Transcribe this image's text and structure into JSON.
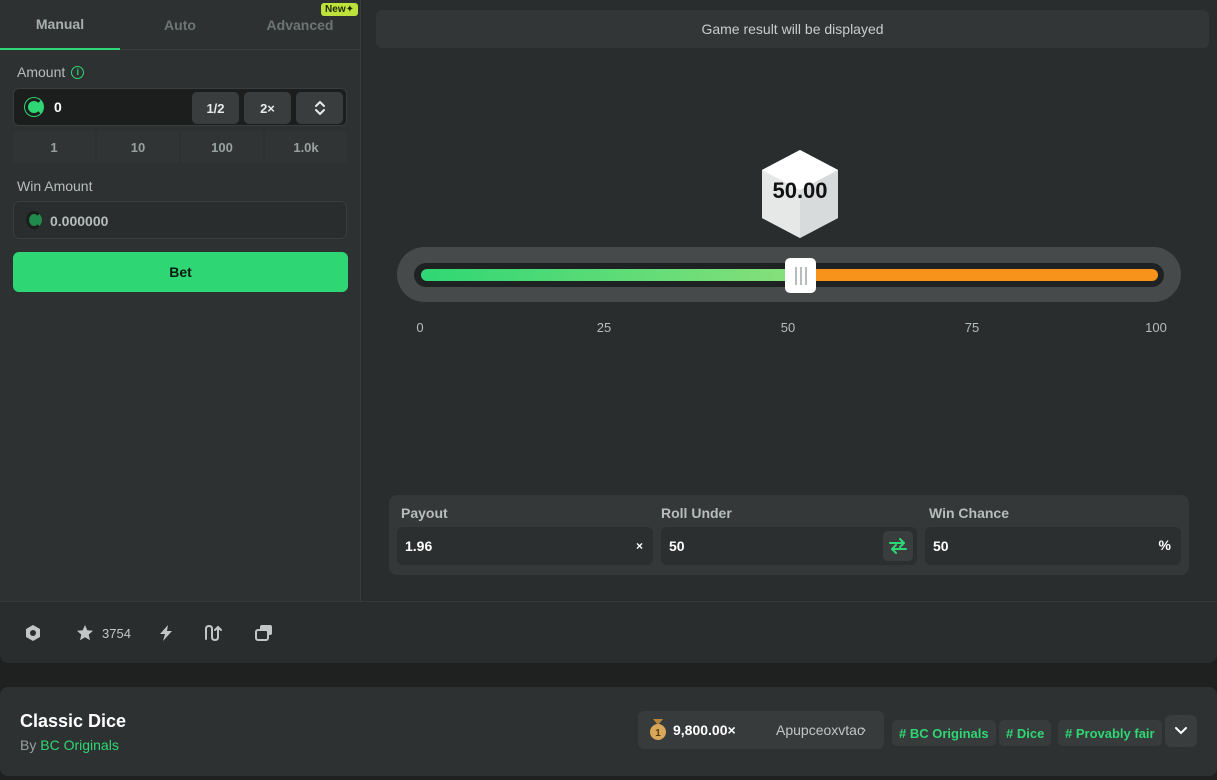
{
  "tabs": [
    {
      "label": "Manual",
      "active": true
    },
    {
      "label": "Auto",
      "active": false
    },
    {
      "label": "Advanced",
      "active": false,
      "badge": "New✦"
    }
  ],
  "amount": {
    "label": "Amount",
    "value": "0",
    "half_label": "1/2",
    "double_label": "2×",
    "quick": [
      "1",
      "10",
      "100",
      "1.0k"
    ]
  },
  "win_amount": {
    "label": "Win Amount",
    "value": "0.000000"
  },
  "bet_label": "Bet",
  "result_text": "Game result will be displayed",
  "dice_value": "50.00",
  "slider": {
    "roll_under": 50,
    "ticks": [
      "0",
      "25",
      "50",
      "75",
      "100"
    ]
  },
  "controls": {
    "payout": {
      "label": "Payout",
      "value": "1.96",
      "suffix": "×"
    },
    "roll_under": {
      "label": "Roll Under",
      "value": "50"
    },
    "win_chance": {
      "label": "Win Chance",
      "value": "50",
      "suffix": "%"
    }
  },
  "toolbar": {
    "favorites_count": "3754"
  },
  "footer": {
    "title": "Classic Dice",
    "by": "By",
    "provider": "BC Originals",
    "top_win": {
      "multiplier": "9,800.00×",
      "player": "Apupceoxvtac"
    },
    "tags": [
      "# BC Originals",
      "# Dice",
      "# Provably fair"
    ]
  },
  "colors": {
    "accent": "#2fd774",
    "win_zone": "#f7931a",
    "badge": "#bde23b"
  }
}
